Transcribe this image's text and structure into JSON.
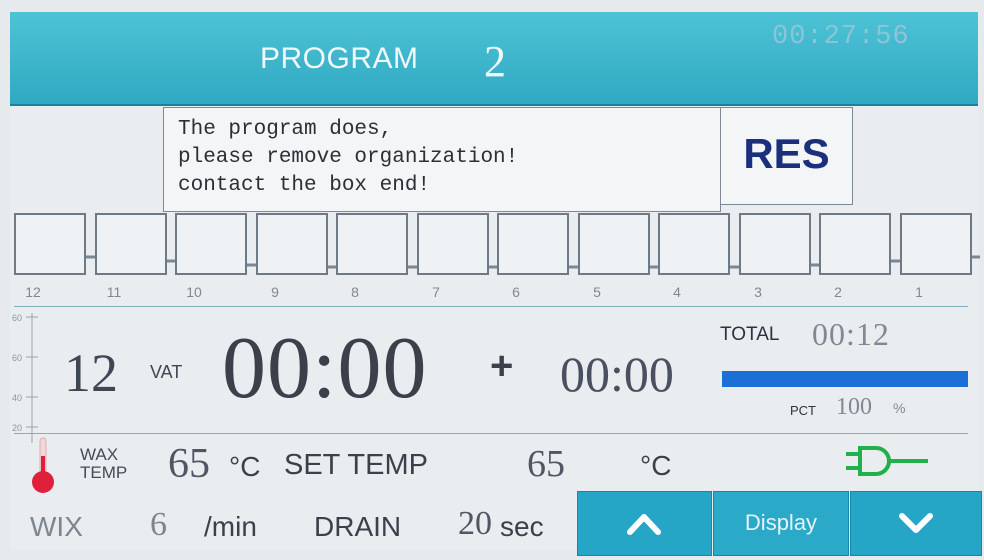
{
  "header": {
    "title": "PROGRAM",
    "program_number": "2",
    "clock": "00:27:56"
  },
  "message": {
    "lines": [
      "The program does,",
      "please remove organization!",
      "contact the box end!"
    ],
    "res_label": "RES"
  },
  "stations": [
    "12",
    "11",
    "10",
    "9",
    "8",
    "7",
    "6",
    "5",
    "4",
    "3",
    "2",
    "1"
  ],
  "scale": {
    "ticks": [
      "60",
      "60",
      "40",
      "20"
    ]
  },
  "status": {
    "vat_number": "12",
    "vat_label": "VAT",
    "main_time": "00:00",
    "plus": "+",
    "sub_time": "00:00",
    "total_label": "TOTAL",
    "total_time": "00:12",
    "pct_label": "PCT",
    "pct_value": "100",
    "pct_sign": "%",
    "progress_fraction": 1.0
  },
  "temp": {
    "wax_label_1": "WAX",
    "wax_label_2": "TEMP",
    "wax_value": "65",
    "wax_unit": "°C",
    "set_label": "SET TEMP",
    "set_value": "65",
    "set_unit": "°C"
  },
  "footer": {
    "wix_label": "WIX",
    "wix_value": "6",
    "wix_unit": "/min",
    "drain_label": "DRAIN",
    "drain_value": "20",
    "drain_unit": "sec",
    "display_label": "Display"
  },
  "colors": {
    "accent": "#26a6c6",
    "progress": "#1d6fd8",
    "thermo": "#e0203a",
    "plug": "#22b04a"
  },
  "icons": {
    "up": "chevron-up-icon",
    "down": "chevron-down-icon",
    "plug": "plug-icon",
    "thermo": "thermometer-icon"
  }
}
